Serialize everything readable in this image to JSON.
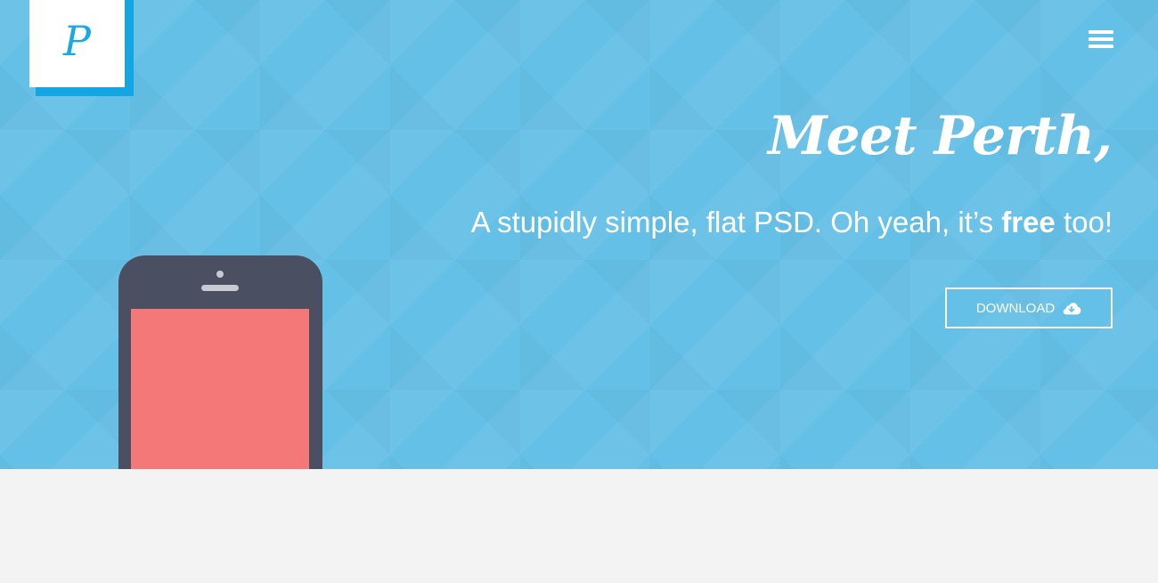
{
  "header": {
    "logo_letter": "P",
    "menu_icon": "hamburger-menu-icon"
  },
  "hero": {
    "title": "Meet Perth,",
    "tagline_prefix": "A stupidly simple, flat PSD. Oh yeah, it’s ",
    "tagline_bold": "free",
    "tagline_suffix": " too!",
    "download_label": "DOWNLOAD",
    "download_icon": "cloud-download-icon"
  },
  "colors": {
    "hero_background": "#64c0e6",
    "logo_accent": "#15a6e2",
    "phone_body": "#4b4f62",
    "phone_screen": "#f47878",
    "page_background": "#f3f3f3"
  }
}
